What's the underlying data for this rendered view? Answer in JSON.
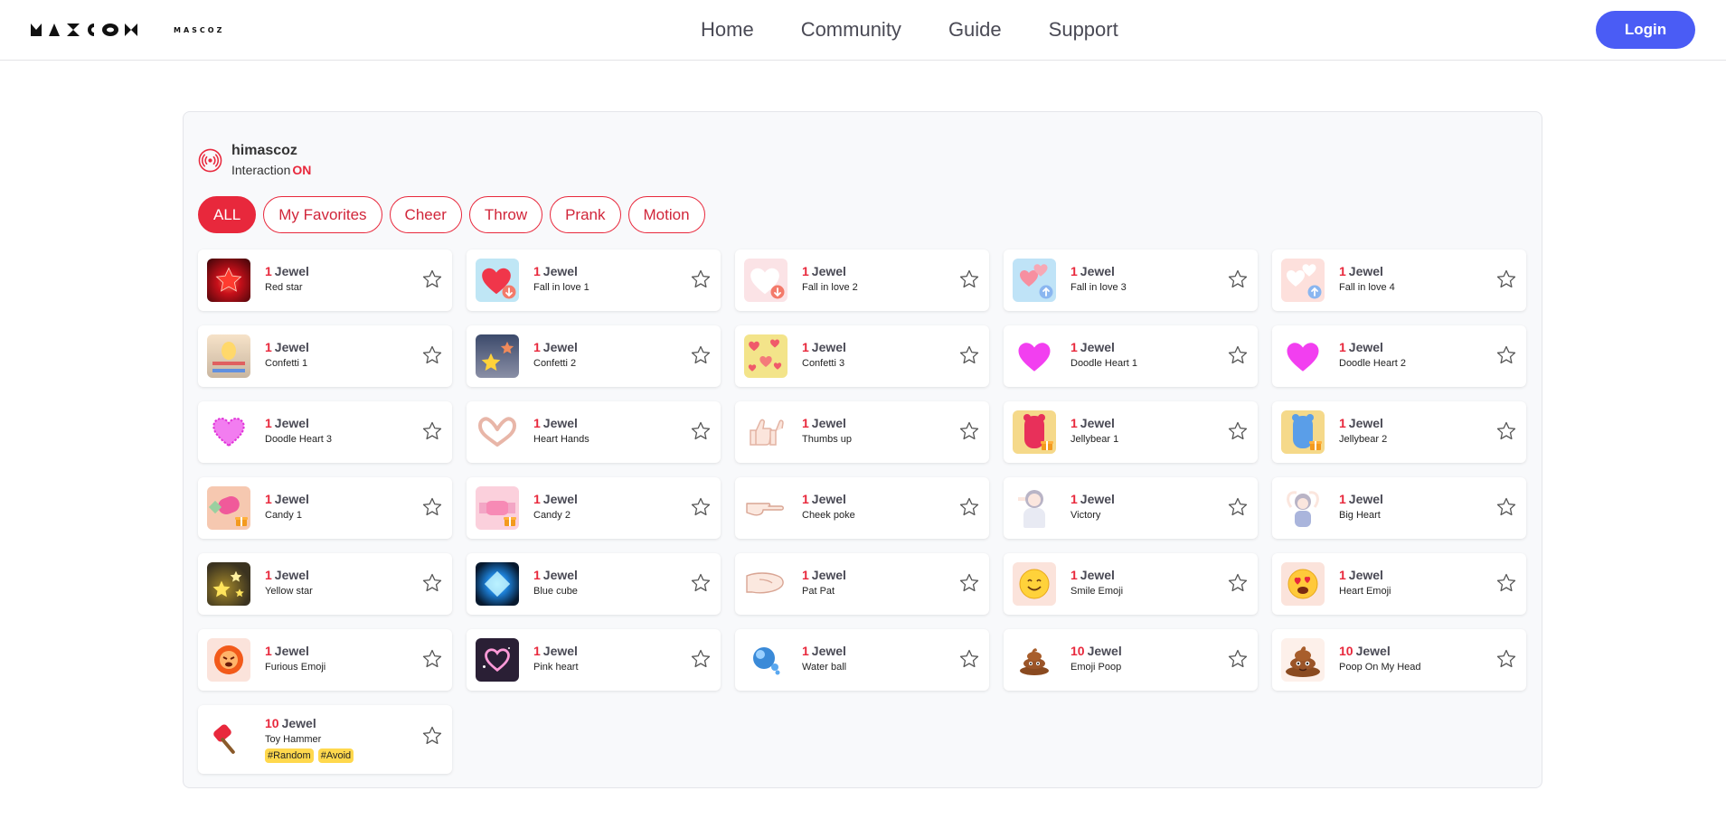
{
  "header": {
    "brand_text": "MASCOZ",
    "nav": [
      "Home",
      "Community",
      "Guide",
      "Support"
    ],
    "login_label": "Login"
  },
  "user": {
    "name": "himascoz",
    "status_label": "Interaction",
    "status_value": "ON"
  },
  "filters": [
    {
      "label": "ALL",
      "active": true
    },
    {
      "label": "My Favorites",
      "active": false
    },
    {
      "label": "Cheer",
      "active": false
    },
    {
      "label": "Throw",
      "active": false
    },
    {
      "label": "Prank",
      "active": false
    },
    {
      "label": "Motion",
      "active": false
    }
  ],
  "currency": "Jewel",
  "colors": {
    "accent": "#e8283c",
    "login": "#4a5cf5",
    "tag": "#ffd84d"
  },
  "items": [
    {
      "price": "1",
      "name": "Red star",
      "icon": "red-star-burst"
    },
    {
      "price": "1",
      "name": "Fall in love 1",
      "icon": "red-heart-download"
    },
    {
      "price": "1",
      "name": "Fall in love 2",
      "icon": "white-heart-download"
    },
    {
      "price": "1",
      "name": "Fall in love 3",
      "icon": "pink-hearts-upload"
    },
    {
      "price": "1",
      "name": "Fall in love 4",
      "icon": "white-hearts-upload"
    },
    {
      "price": "1",
      "name": "Confetti 1",
      "icon": "balloon-confetti"
    },
    {
      "price": "1",
      "name": "Confetti 2",
      "icon": "star-confetti"
    },
    {
      "price": "1",
      "name": "Confetti 3",
      "icon": "heart-confetti"
    },
    {
      "price": "1",
      "name": "Doodle Heart 1",
      "icon": "doodle-heart"
    },
    {
      "price": "1",
      "name": "Doodle Heart 2",
      "icon": "doodle-heart"
    },
    {
      "price": "1",
      "name": "Doodle Heart 3",
      "icon": "doodle-heart-scribble"
    },
    {
      "price": "1",
      "name": "Heart Hands",
      "icon": "heart-hands"
    },
    {
      "price": "1",
      "name": "Thumbs up",
      "icon": "thumbs-up"
    },
    {
      "price": "1",
      "name": "Jellybear 1",
      "icon": "jellybear-red"
    },
    {
      "price": "1",
      "name": "Jellybear 2",
      "icon": "jellybear-blue"
    },
    {
      "price": "1",
      "name": "Candy 1",
      "icon": "candy-pink"
    },
    {
      "price": "1",
      "name": "Candy 2",
      "icon": "candy-wrapped"
    },
    {
      "price": "1",
      "name": "Cheek poke",
      "icon": "pointing-finger"
    },
    {
      "price": "1",
      "name": "Victory",
      "icon": "avatar-victory"
    },
    {
      "price": "1",
      "name": "Big Heart",
      "icon": "avatar-big-heart"
    },
    {
      "price": "1",
      "name": "Yellow star",
      "icon": "yellow-star-sparkle"
    },
    {
      "price": "1",
      "name": "Blue cube",
      "icon": "blue-cube-glow"
    },
    {
      "price": "1",
      "name": "Pat Pat",
      "icon": "patting-hand"
    },
    {
      "price": "1",
      "name": "Smile Emoji",
      "icon": "smile-emoji"
    },
    {
      "price": "1",
      "name": "Heart Emoji",
      "icon": "heart-eyes-emoji"
    },
    {
      "price": "1",
      "name": "Furious Emoji",
      "icon": "furious-emoji"
    },
    {
      "price": "1",
      "name": "Pink heart",
      "icon": "pink-heart-neon"
    },
    {
      "price": "1",
      "name": "Water ball",
      "icon": "water-ball"
    },
    {
      "price": "10",
      "name": "Emoji Poop",
      "icon": "poop-emoji"
    },
    {
      "price": "10",
      "name": "Poop On My Head",
      "icon": "poop-big-emoji"
    },
    {
      "price": "10",
      "name": "Toy Hammer",
      "icon": "toy-hammer",
      "tags": [
        "#Random",
        "#Avoid"
      ]
    }
  ]
}
